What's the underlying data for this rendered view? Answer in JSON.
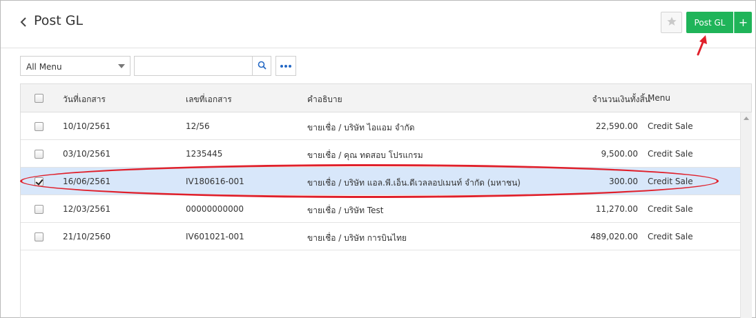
{
  "header": {
    "title": "Post GL",
    "post_button_label": "Post GL",
    "plus_label": "+"
  },
  "toolbar": {
    "menu_select_value": "All Menu",
    "search_placeholder": ""
  },
  "table": {
    "columns": {
      "date": "วันที่เอกสาร",
      "doc_no": "เลขที่เอกสาร",
      "description": "คำอธิบาย",
      "amount": "จำนวนเงินทั้งสิ้น",
      "menu": "Menu"
    },
    "rows": [
      {
        "date": "10/10/2561",
        "doc_no": "12/56",
        "description": "ขายเชื่อ / บริษัท ไอแอม จำกัด",
        "amount": "22,590.00",
        "menu": "Credit Sale",
        "checked": false
      },
      {
        "date": "03/10/2561",
        "doc_no": "1235445",
        "description": "ขายเชื่อ / คุณ ทดสอบ โปรแกรม",
        "amount": "9,500.00",
        "menu": "Credit Sale",
        "checked": false
      },
      {
        "date": "16/06/2561",
        "doc_no": "IV180616-001",
        "description": "ขายเชื่อ / บริษัท แอล.พี.เอ็น.ดีเวลลอปเมนท์ จำกัด (มหาชน)",
        "amount": "300.00",
        "menu": "Credit Sale",
        "checked": true
      },
      {
        "date": "12/03/2561",
        "doc_no": "00000000000",
        "description": "ขายเชื่อ / บริษัท Test",
        "amount": "11,270.00",
        "menu": "Credit Sale",
        "checked": false
      },
      {
        "date": "21/10/2560",
        "doc_no": "IV601021-001",
        "description": "ขายเชื่อ / บริษัท การบินไทย",
        "amount": "489,020.00",
        "menu": "Credit Sale",
        "checked": false
      }
    ]
  },
  "colors": {
    "accent_green": "#1fb459",
    "selected_row": "#d8e7fa",
    "annotation_red": "#e0202b"
  }
}
